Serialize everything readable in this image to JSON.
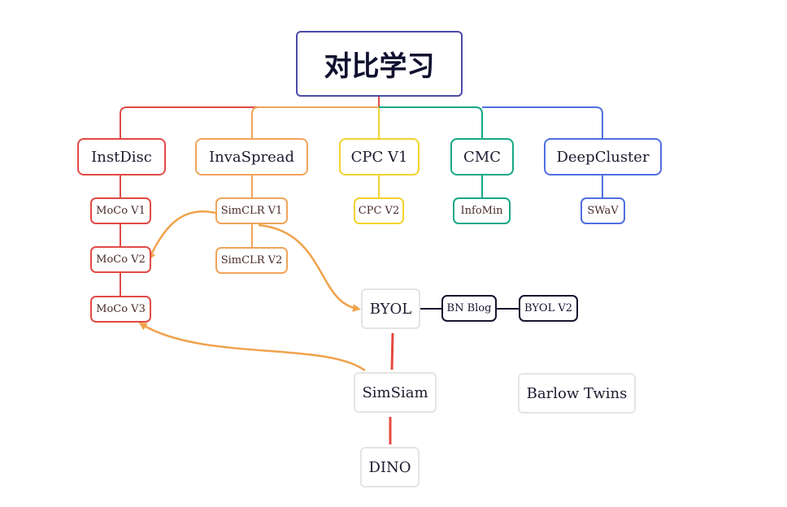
{
  "root": {
    "label": "对比学习"
  },
  "columns": [
    {
      "label": "InstDisc",
      "color": "#e24a45",
      "children": [
        "MoCo V1",
        "MoCo V2",
        "MoCo V3"
      ]
    },
    {
      "label": "InvaSpread",
      "color": "#f0a45a",
      "children": [
        "SimCLR V1",
        "SimCLR V2"
      ]
    },
    {
      "label": "CPC V1",
      "color": "#f2d22e",
      "children": [
        "CPC V2"
      ]
    },
    {
      "label": "CMC",
      "color": "#16a886",
      "children": [
        "InfoMin"
      ]
    },
    {
      "label": "DeepCluster",
      "color": "#4f6fe0",
      "children": [
        "SWaV"
      ]
    }
  ],
  "byol_branch": {
    "byol": "BYOL",
    "bn_blog": "BN Blog",
    "byol_v2": "BYOL V2"
  },
  "simsiam_branch": {
    "simsiam": "SimSiam",
    "dino": "DINO"
  },
  "standalone": {
    "barlow_twins": "Barlow Twins"
  },
  "edge_colors": {
    "influence_arrow": "#f0a24c",
    "simsiam_link": "#e5483f",
    "byol_link": "#14142e"
  }
}
